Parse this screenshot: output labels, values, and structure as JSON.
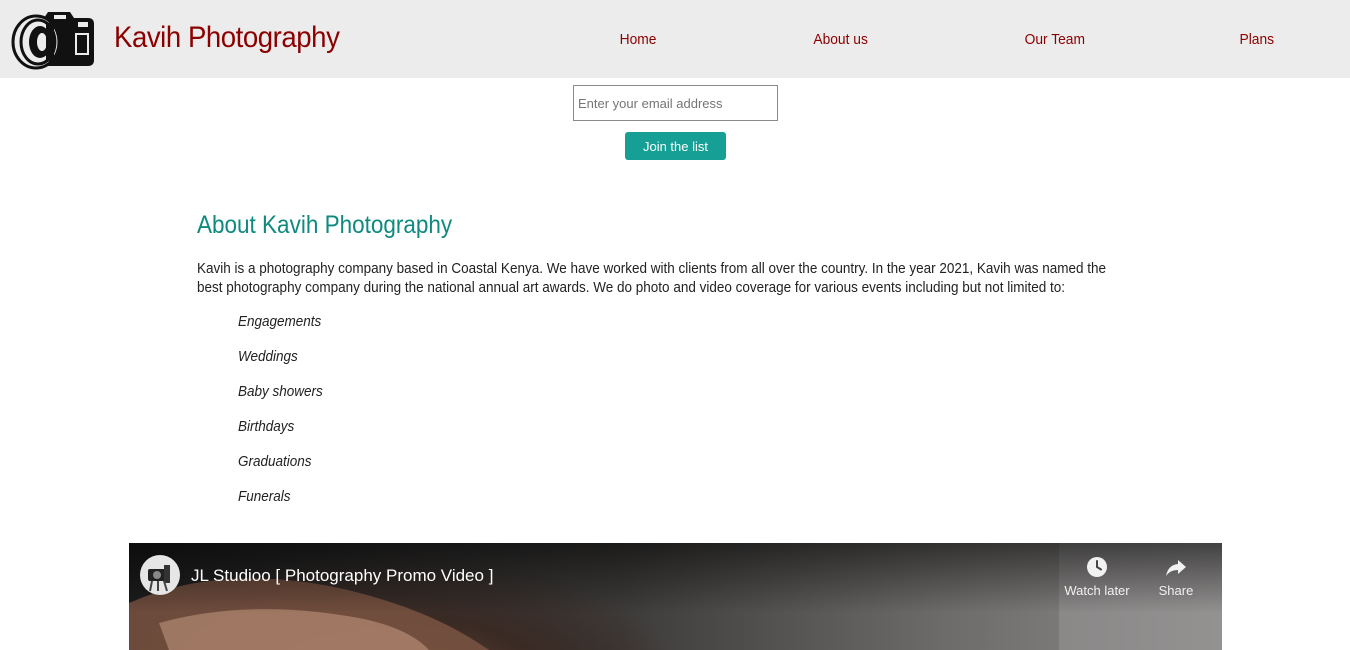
{
  "header": {
    "brand": "Kavih Photography",
    "logo_icon": "camera-logo-icon",
    "nav": [
      {
        "label": "Home"
      },
      {
        "label": "About us"
      },
      {
        "label": "Our Team"
      },
      {
        "label": "Plans"
      }
    ]
  },
  "newsletter": {
    "email_placeholder": "Enter your email address",
    "email_value": "",
    "button_label": "Join the list"
  },
  "about": {
    "title": "About Kavih Photography",
    "paragraph": "Kavih is a photography company based in Coastal Kenya. We have worked with clients from all over the country. In the year 2021, Kavih was named the best photography company during the national annual art awards. We do photo and video coverage for various events including but not limited to:",
    "events": [
      "Engagements",
      "Weddings",
      "Baby showers",
      "Birthdays",
      "Graduations",
      "Funerals"
    ]
  },
  "video": {
    "title": "JL Studioo [ Photography Promo Video ]",
    "watch_later_label": "Watch later",
    "share_label": "Share",
    "icons": [
      "channel-avatar",
      "clock-icon",
      "share-icon"
    ]
  },
  "colors": {
    "header_bg": "#ececec",
    "brand": "#8b0000",
    "accent": "#16a095",
    "heading": "#0e8a7f"
  }
}
